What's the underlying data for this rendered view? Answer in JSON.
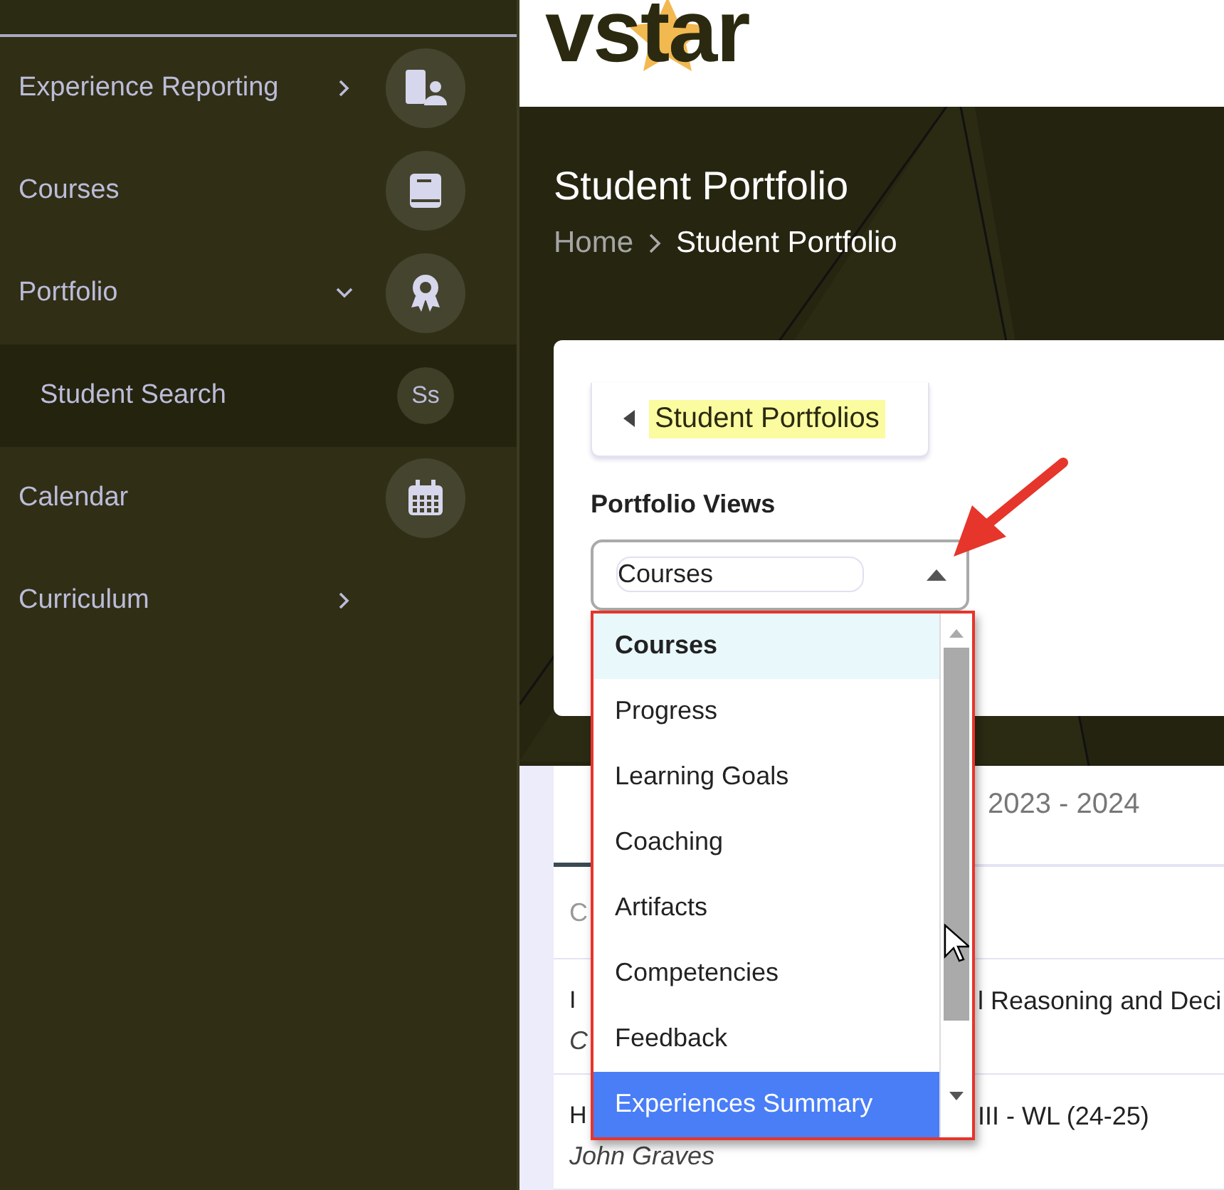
{
  "sidebar": {
    "items": [
      {
        "label": "Experience Reporting",
        "expanded": false,
        "selected": false
      },
      {
        "label": "Courses",
        "selected": false
      },
      {
        "label": "Portfolio",
        "expanded": true,
        "selected": false,
        "children": [
          {
            "label": "Student Search",
            "badge": "Ss",
            "selected": true
          }
        ]
      },
      {
        "label": "Calendar",
        "selected": false
      },
      {
        "label": "Curriculum",
        "expanded": false,
        "selected": false
      }
    ]
  },
  "header": {
    "logo": "vstar"
  },
  "page": {
    "title": "Student Portfolio",
    "breadcrumb": [
      "Home",
      "Student Portfolio"
    ]
  },
  "card": {
    "back_button": {
      "label": "Student Portfolios",
      "highlighted": true
    },
    "field_label": "Portfolio Views",
    "select": {
      "value": "Courses",
      "expanded": true,
      "options": [
        {
          "label": "Courses",
          "selected": true,
          "highlighted": false
        },
        {
          "label": "Progress",
          "selected": false,
          "highlighted": false
        },
        {
          "label": "Learning Goals",
          "selected": false,
          "highlighted": false
        },
        {
          "label": "Coaching",
          "selected": false,
          "highlighted": false
        },
        {
          "label": "Artifacts",
          "selected": false,
          "highlighted": false
        },
        {
          "label": "Competencies",
          "selected": false,
          "highlighted": false
        },
        {
          "label": "Feedback",
          "selected": false,
          "highlighted": false
        },
        {
          "label": "Experiences Summary",
          "selected": false,
          "highlighted": true
        }
      ]
    }
  },
  "tabs": [
    {
      "label": "2023 - 2024",
      "selected": false
    }
  ],
  "table": {
    "header": "C",
    "rows": [
      {
        "column_1": "I",
        "column_1_sub": "C",
        "column_2": "l Reasoning and Deci"
      },
      {
        "column_1": "H",
        "column_1_sub": "John Graves",
        "column_2": "III - WL (24-25)"
      }
    ]
  }
}
